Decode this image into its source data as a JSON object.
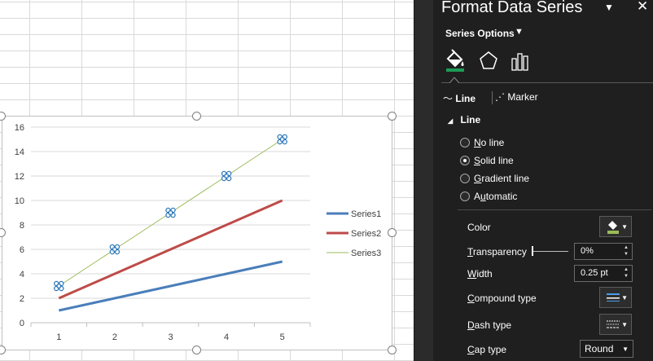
{
  "pane": {
    "title": "Format Data Series",
    "series_options_label": "Series Options",
    "icon_tabs": [
      "fill-line-icon",
      "effects-icon",
      "series-options-icon"
    ],
    "subtabs": {
      "line": "Line",
      "marker": "Marker"
    },
    "section_title": "Line",
    "line_options": [
      {
        "label": "No line",
        "checked": false
      },
      {
        "label": "Solid line",
        "checked": true
      },
      {
        "label": "Gradient line",
        "checked": false
      },
      {
        "label": "Automatic",
        "checked": false
      }
    ],
    "props": {
      "color_label": "Color",
      "transparency_label": "Transparency",
      "transparency_value": "0%",
      "width_label": "Width",
      "width_value": "0.25 pt",
      "compound_label": "Compound type",
      "dash_label": "Dash type",
      "cap_label": "Cap type",
      "cap_value": "Round"
    },
    "colors": {
      "background": "#1f1f1f",
      "accent": "#1e9b56"
    }
  },
  "chart_data": {
    "type": "line",
    "x": [
      1,
      2,
      3,
      4,
      5
    ],
    "series": [
      {
        "name": "Series1",
        "values": [
          1,
          2,
          3,
          4,
          5
        ],
        "color": "#4a7ebb"
      },
      {
        "name": "Series2",
        "values": [
          2,
          4,
          6,
          8,
          10
        ],
        "color": "#be4b48"
      },
      {
        "name": "Series3",
        "values": [
          3,
          6,
          9,
          12,
          15
        ],
        "color": "#9bbb59",
        "selected": true
      }
    ],
    "y_ticks": [
      "0",
      "2",
      "4",
      "6",
      "8",
      "10",
      "12",
      "14",
      "16"
    ],
    "x_ticks": [
      "1",
      "2",
      "3",
      "4",
      "5"
    ],
    "ylim": [
      0,
      16
    ],
    "grid": true,
    "legend": "right"
  }
}
